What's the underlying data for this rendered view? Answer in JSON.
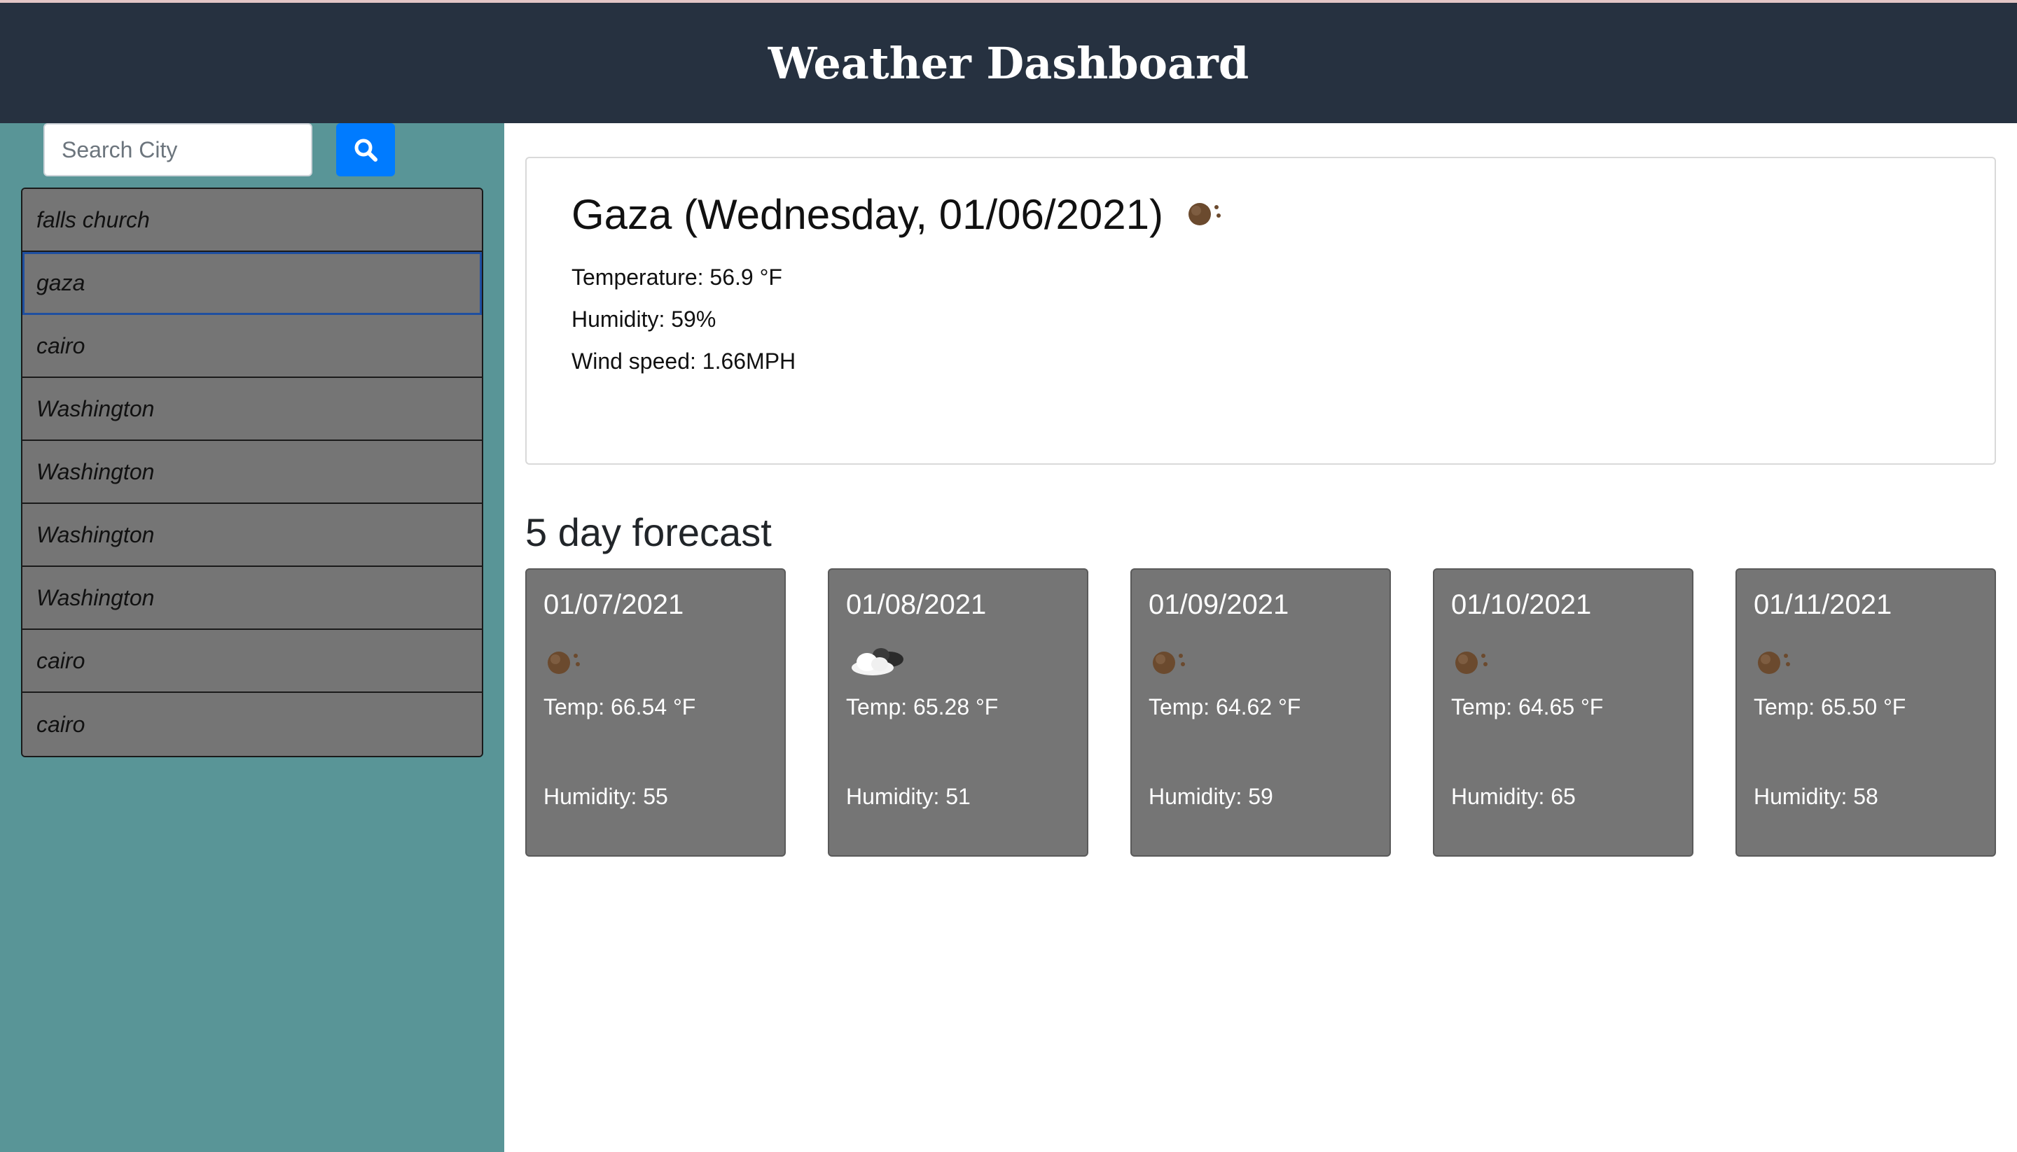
{
  "header": {
    "title": "Weather Dashboard"
  },
  "search": {
    "placeholder": "Search City",
    "button_icon": "search-icon"
  },
  "history": [
    "falls church",
    "gaza",
    "cairo",
    "Washington",
    "Washington",
    "Washington",
    "Washington",
    "cairo",
    "cairo"
  ],
  "current": {
    "title": "Gaza (Wednesday, 01/06/2021)",
    "icon": "clear-night-icon",
    "temperature": "Temperature: 56.9 °F",
    "humidity": "Humidity: 59%",
    "wind": "Wind speed: 1.66MPH"
  },
  "forecast": {
    "title": "5 day forecast",
    "days": [
      {
        "date": "01/07/2021",
        "icon": "clear-night-icon",
        "temp": "Temp: 66.54 °F",
        "humidity": "Humidity: 55"
      },
      {
        "date": "01/08/2021",
        "icon": "cloudy-night-icon",
        "temp": "Temp: 65.28 °F",
        "humidity": "Humidity: 51"
      },
      {
        "date": "01/09/2021",
        "icon": "clear-night-icon",
        "temp": "Temp: 64.62 °F",
        "humidity": "Humidity: 59"
      },
      {
        "date": "01/10/2021",
        "icon": "clear-night-icon",
        "temp": "Temp: 64.65 °F",
        "humidity": "Humidity: 65"
      },
      {
        "date": "01/11/2021",
        "icon": "clear-night-icon",
        "temp": "Temp: 65.50 °F",
        "humidity": "Humidity: 58"
      }
    ]
  },
  "colors": {
    "header_bg": "#263140",
    "sidebar_bg": "#599597",
    "search_button": "#007bff",
    "history_item_bg": "#757575",
    "forecast_card_bg": "#757575"
  }
}
